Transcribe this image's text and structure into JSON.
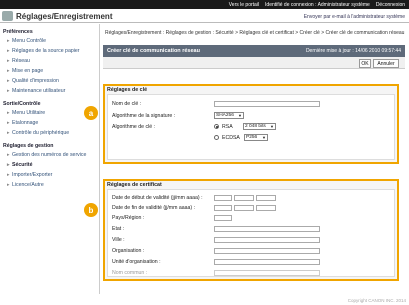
{
  "topbar": {
    "portal": "Vers le portail",
    "login": "Identifié de connexion : Administrateur système",
    "logout": "Déconnexion"
  },
  "header": {
    "title": "Réglages/Enregistrement",
    "mail_link": "Envoyer par e-mail à l'administrateur système"
  },
  "sidebar": {
    "preferences": "Préférences",
    "preferences_items": [
      "Menu Contrôle",
      "Réglages de la source papier",
      "Réseau",
      "Mise en page",
      "Qualité d'impression",
      "Maintenance utilisateur"
    ],
    "output": "Sortie/Contrôle",
    "output_items": [
      "Menu Utilitaire",
      "Etalonnage",
      "Contrôle du périphérique"
    ],
    "management": "Réglages de gestion",
    "management_items": [
      "Gestion des numéros de service",
      "Sécurité",
      "Importer/Exporter",
      "Licence/Autre"
    ],
    "active": "Sécurité"
  },
  "breadcrumb": "Réglages/Enregistrement : Réglages de gestion : Sécurité > Réglages clé et certificat > Créer clé > Créer clé de communication réseau",
  "page": {
    "title": "Créer clé de communication réseau",
    "updated": "Dernière mise à jour : 14/06 2010 09:57:44",
    "ok": "OK",
    "cancel": "Annuler"
  },
  "key_settings": {
    "title": "Réglages de clé",
    "key_name_label": "Nom de clé :",
    "key_name_value": "",
    "signature_label": "Algorithme de la signature :",
    "signature_value": "SHA256",
    "key_algo_label": "Algorithme de clé :",
    "rsa_label": "RSA",
    "rsa_value": "2 048 bits",
    "ecdsa_label": "ECDSA",
    "ecdsa_value": "P256",
    "selected": "RSA"
  },
  "cert_settings": {
    "title": "Réglages de certificat",
    "start_label": "Date de début de validité (jj/mm aaaa) :",
    "end_label": "Date de fin de validité (jj/mm aaaa) :",
    "country_label": "Pays/Région :",
    "state_label": "Etat :",
    "city_label": "Ville :",
    "org_label": "Organisation :",
    "unit_label": "Unité d'organisation :",
    "common_label": "Nom commun :"
  },
  "markers": {
    "a": "a",
    "b": "b"
  },
  "footer": "Copyright CANON INC. 2014",
  "colors": {
    "accent": "#f0a500",
    "pagebar": "#5e6a7a",
    "link": "#34537a"
  }
}
